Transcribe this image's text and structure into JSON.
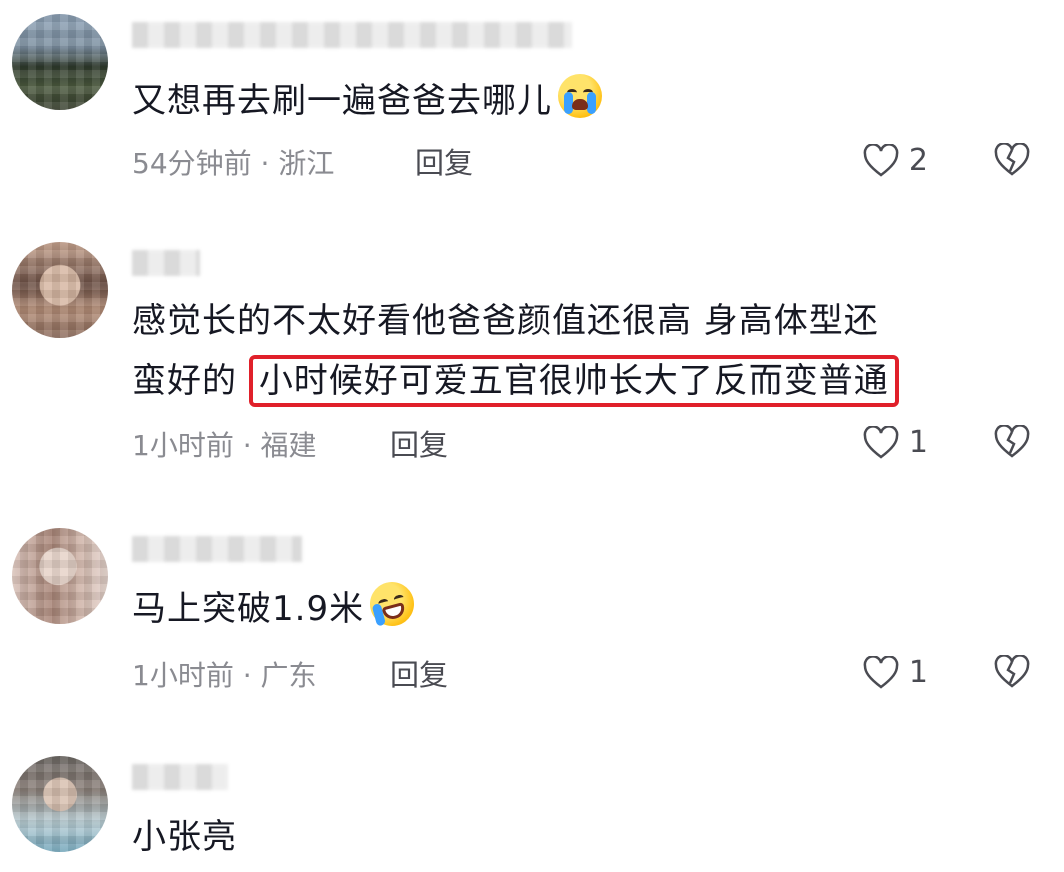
{
  "comments": [
    {
      "text": "又想再去刷一遍爸爸去哪儿",
      "emoji": "loudly-crying-face",
      "meta": "54分钟前 · 浙江",
      "reply_label": "回复",
      "likes": "2"
    },
    {
      "text_before": "感觉长的不太好看他爸爸颜值还很高  身高体型还",
      "text_line2_prefix": "蛮好的 ",
      "text_highlighted": "小时候好可爱五官很帅长大了反而变普通",
      "meta": "1小时前 · 福建",
      "reply_label": "回复",
      "likes": "1"
    },
    {
      "text": "马上突破1.9米",
      "emoji": "rolling-on-floor-laughing",
      "meta": "1小时前 · 广东",
      "reply_label": "回复",
      "likes": "1"
    },
    {
      "text": "小张亮"
    }
  ],
  "colors": {
    "highlight_border": "#e0202a",
    "meta_text": "#8a8b91",
    "main_text": "#161823"
  },
  "icons": {
    "like": "heart-outline-icon",
    "dislike": "broken-heart-icon"
  }
}
